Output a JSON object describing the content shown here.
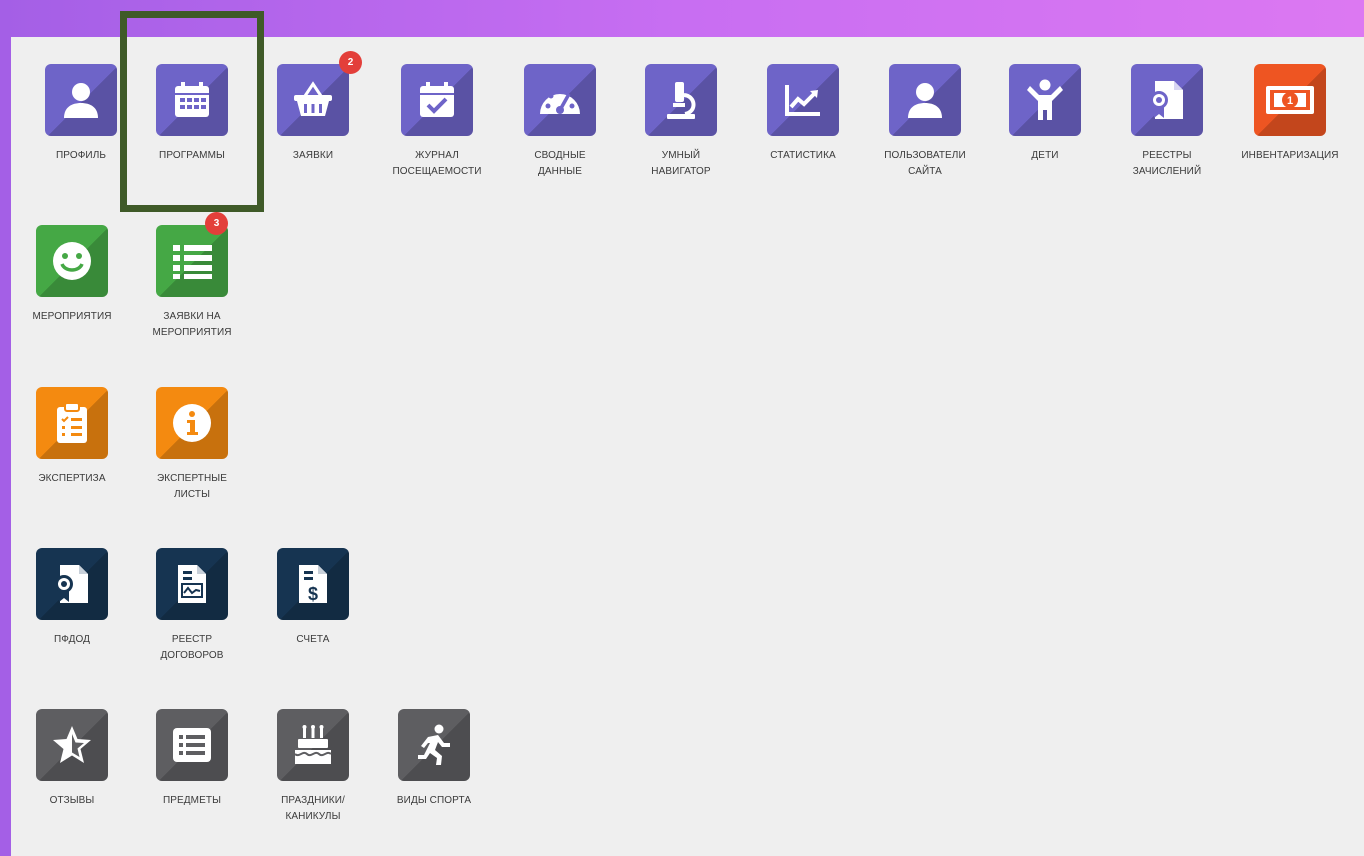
{
  "tiles": {
    "profile": {
      "label": "ПРОФИЛЬ",
      "icon": "user-icon"
    },
    "programs": {
      "label": "ПРОГРАММЫ",
      "icon": "calendar-icon"
    },
    "applications": {
      "label": "ЗАЯВКИ",
      "icon": "basket-icon",
      "badge": "2"
    },
    "attendance": {
      "label_line1": "ЖУРНАЛ",
      "label_line2": "ПОСЕЩАЕМОСТИ",
      "icon": "calendar-check-icon"
    },
    "summary": {
      "label_line1": "СВОДНЫЕ",
      "label_line2": "ДАННЫЕ",
      "icon": "speedometer-icon"
    },
    "navigator": {
      "label_line1": "УМНЫЙ",
      "label_line2": "НАВИГАТОР",
      "icon": "microscope-icon"
    },
    "statistics": {
      "label": "СТАТИСТИКА",
      "icon": "line-chart-icon"
    },
    "site_users": {
      "label_line1": "ПОЛЬЗОВАТЕЛИ",
      "label_line2": "САЙТА",
      "icon": "user-icon"
    },
    "children": {
      "label": "ДЕТИ",
      "icon": "child-icon"
    },
    "enrollment_registers": {
      "label_line1": "РЕЕСТРЫ",
      "label_line2": "ЗАЧИСЛЕНИЙ",
      "icon": "certificate-document-icon"
    },
    "inventory": {
      "label": "ИНВЕНТАРИЗАЦИЯ",
      "icon": "money-icon"
    },
    "events": {
      "label": "МЕРОПРИЯТИЯ",
      "icon": "smile-icon"
    },
    "event_applications": {
      "label_line1": "ЗАЯВКИ НА",
      "label_line2": "МЕРОПРИЯТИЯ",
      "icon": "list-icon",
      "badge": "3"
    },
    "expertise": {
      "label": "ЭКСПЕРТИЗА",
      "icon": "clipboard-check-icon"
    },
    "expert_sheets": {
      "label_line1": "ЭКСПЕРТНЫЕ",
      "label_line2": "ЛИСТЫ",
      "icon": "info-icon"
    },
    "pfdod": {
      "label": "ПФДОД",
      "icon": "certificate-document-icon"
    },
    "contracts_register": {
      "label_line1": "РЕЕСТР",
      "label_line2": "ДОГОВОРОВ",
      "icon": "contract-document-icon"
    },
    "invoices": {
      "label": "СЧЕТА",
      "icon": "invoice-dollar-icon"
    },
    "reviews": {
      "label": "ОТЗЫВЫ",
      "icon": "star-icon"
    },
    "subjects": {
      "label": "ПРЕДМЕТЫ",
      "icon": "list-box-icon"
    },
    "holidays": {
      "label_line1": "ПРАЗДНИКИ/",
      "label_line2": "КАНИКУЛЫ",
      "icon": "birthday-cake-icon"
    },
    "sports": {
      "label": "ВИДЫ СПОРТА",
      "icon": "running-icon"
    }
  },
  "colors": {
    "purple": "#6e64c8",
    "orange_red": "#ee5522",
    "green": "#45a845",
    "orange": "#f48a10",
    "navy": "#163451",
    "gray": "#5e5e61",
    "badge": "#e33f3a",
    "highlight_border": "#3f5a28"
  }
}
